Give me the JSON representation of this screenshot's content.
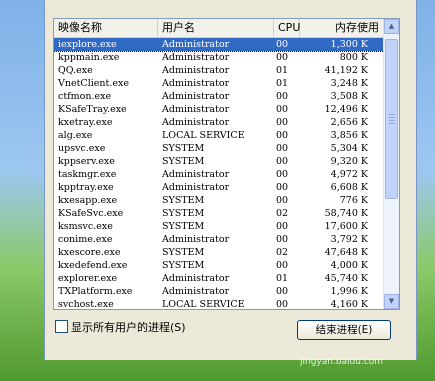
{
  "header": {
    "name": "映像名称",
    "user": "用户名",
    "cpu": "CPU",
    "mem": "内存使用"
  },
  "rows": [
    {
      "name": "iexplore.exe",
      "user": "Administrator",
      "cpu": "00",
      "mem": "1,300 K",
      "selected": true
    },
    {
      "name": "kppmain.exe",
      "user": "Administrator",
      "cpu": "00",
      "mem": "800 K"
    },
    {
      "name": "QQ.exe",
      "user": "Administrator",
      "cpu": "01",
      "mem": "41,192 K"
    },
    {
      "name": "VnetClient.exe",
      "user": "Administrator",
      "cpu": "01",
      "mem": "3,248 K"
    },
    {
      "name": "ctfmon.exe",
      "user": "Administrator",
      "cpu": "00",
      "mem": "3,508 K"
    },
    {
      "name": "KSafeTray.exe",
      "user": "Administrator",
      "cpu": "00",
      "mem": "12,496 K"
    },
    {
      "name": "kxetray.exe",
      "user": "Administrator",
      "cpu": "00",
      "mem": "2,656 K"
    },
    {
      "name": "alg.exe",
      "user": "LOCAL SERVICE",
      "cpu": "00",
      "mem": "3,856 K"
    },
    {
      "name": "upsvc.exe",
      "user": "SYSTEM",
      "cpu": "00",
      "mem": "5,304 K"
    },
    {
      "name": "kppserv.exe",
      "user": "SYSTEM",
      "cpu": "00",
      "mem": "9,320 K"
    },
    {
      "name": "taskmgr.exe",
      "user": "Administrator",
      "cpu": "00",
      "mem": "4,972 K"
    },
    {
      "name": "kpptray.exe",
      "user": "Administrator",
      "cpu": "00",
      "mem": "6,608 K"
    },
    {
      "name": "kxesapp.exe",
      "user": "SYSTEM",
      "cpu": "00",
      "mem": "776 K"
    },
    {
      "name": "KSafeSvc.exe",
      "user": "SYSTEM",
      "cpu": "02",
      "mem": "58,740 K"
    },
    {
      "name": "ksmsvc.exe",
      "user": "SYSTEM",
      "cpu": "00",
      "mem": "17,600 K"
    },
    {
      "name": "conime.exe",
      "user": "Administrator",
      "cpu": "00",
      "mem": "3,792 K"
    },
    {
      "name": "kxescore.exe",
      "user": "SYSTEM",
      "cpu": "02",
      "mem": "47,648 K"
    },
    {
      "name": "kxedefend.exe",
      "user": "SYSTEM",
      "cpu": "00",
      "mem": "4,000 K"
    },
    {
      "name": "explorer.exe",
      "user": "Administrator",
      "cpu": "01",
      "mem": "45,740 K"
    },
    {
      "name": "TXPlatform.exe",
      "user": "Administrator",
      "cpu": "00",
      "mem": "1,996 K"
    },
    {
      "name": "svchost.exe",
      "user": "LOCAL SERVICE",
      "cpu": "00",
      "mem": "4,160 K"
    }
  ],
  "show_all_label": "显示所有用户的进程(S)",
  "end_process_label": "结束进程(E)",
  "watermark": "jingyan.baidu.com",
  "colors": {
    "selection": "#316ac5",
    "window_bg": "#ece9d8"
  }
}
